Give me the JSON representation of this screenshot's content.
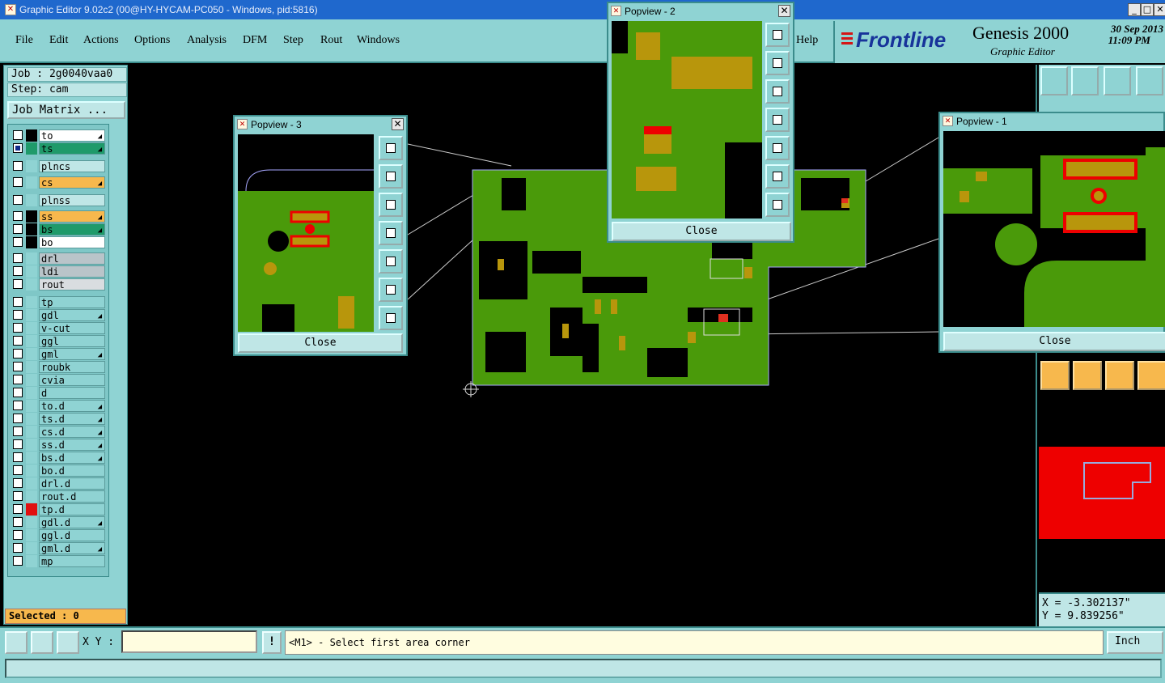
{
  "window": {
    "title": "Graphic Editor 9.02c2 (00@HY-HYCAM-PC050 - Windows, pid:5816)"
  },
  "menu": [
    {
      "label": "File"
    },
    {
      "label": "Edit"
    },
    {
      "label": "Actions"
    },
    {
      "label": "Options"
    },
    {
      "label": "Analysis"
    },
    {
      "label": "DFM"
    },
    {
      "label": "Step"
    },
    {
      "label": "Rout"
    },
    {
      "label": "Windows"
    },
    {
      "label": "Help"
    }
  ],
  "brand": {
    "logo": "Frontline",
    "product": "Genesis 2000",
    "subtitle": "Graphic Editor",
    "date": "30 Sep 2013",
    "time": "11:09 PM"
  },
  "job": {
    "job": "Job : 2g0040vaa0",
    "step": "Step: cam",
    "matrix_button": "Job Matrix ..."
  },
  "layers": [
    {
      "name": "to",
      "color": "#ffffff",
      "checked": false,
      "arrow": true,
      "swatch": "#000"
    },
    {
      "name": "ts",
      "color": "#1f9a6a",
      "checked": true,
      "arrow": true,
      "swatch": "#1f9a6a"
    },
    {
      "name": "plncs",
      "color": "#bfe6e6",
      "checked": false,
      "arrow": false,
      "swatch": ""
    },
    {
      "name": "cs",
      "color": "#f7b84d",
      "checked": false,
      "arrow": true,
      "swatch": ""
    },
    {
      "name": "plnss",
      "color": "#bfe6e6",
      "checked": false,
      "arrow": false,
      "swatch": ""
    },
    {
      "name": "ss",
      "color": "#f7b84d",
      "checked": false,
      "arrow": true,
      "swatch": "#000"
    },
    {
      "name": "bs",
      "color": "#1f9a6a",
      "checked": false,
      "arrow": true,
      "swatch": "#000"
    },
    {
      "name": "bo",
      "color": "#ffffff",
      "checked": false,
      "arrow": false,
      "swatch": "#000"
    },
    {
      "name": "drl",
      "color": "#b9c4c9",
      "checked": false,
      "arrow": false,
      "swatch": ""
    },
    {
      "name": "ldi",
      "color": "#b9c4c9",
      "checked": false,
      "arrow": false,
      "swatch": ""
    },
    {
      "name": "rout",
      "color": "#d9dde0",
      "checked": false,
      "arrow": false,
      "swatch": ""
    },
    {
      "name": "tp",
      "color": "#8fd3d3",
      "checked": false,
      "arrow": false,
      "swatch": ""
    },
    {
      "name": "gdl",
      "color": "#8fd3d3",
      "checked": false,
      "arrow": true,
      "swatch": ""
    },
    {
      "name": "v-cut",
      "color": "#8fd3d3",
      "checked": false,
      "arrow": false,
      "swatch": ""
    },
    {
      "name": "ggl",
      "color": "#8fd3d3",
      "checked": false,
      "arrow": false,
      "swatch": ""
    },
    {
      "name": "gml",
      "color": "#8fd3d3",
      "checked": false,
      "arrow": true,
      "swatch": ""
    },
    {
      "name": "roubk",
      "color": "#8fd3d3",
      "checked": false,
      "arrow": false,
      "swatch": ""
    },
    {
      "name": "cvia",
      "color": "#8fd3d3",
      "checked": false,
      "arrow": false,
      "swatch": ""
    },
    {
      "name": "d",
      "color": "#8fd3d3",
      "checked": false,
      "arrow": false,
      "swatch": ""
    },
    {
      "name": "to.d",
      "color": "#8fd3d3",
      "checked": false,
      "arrow": true,
      "swatch": ""
    },
    {
      "name": "ts.d",
      "color": "#8fd3d3",
      "checked": false,
      "arrow": true,
      "swatch": ""
    },
    {
      "name": "cs.d",
      "color": "#8fd3d3",
      "checked": false,
      "arrow": true,
      "swatch": ""
    },
    {
      "name": "ss.d",
      "color": "#8fd3d3",
      "checked": false,
      "arrow": true,
      "swatch": ""
    },
    {
      "name": "bs.d",
      "color": "#8fd3d3",
      "checked": false,
      "arrow": true,
      "swatch": ""
    },
    {
      "name": "bo.d",
      "color": "#8fd3d3",
      "checked": false,
      "arrow": false,
      "swatch": ""
    },
    {
      "name": "drl.d",
      "color": "#8fd3d3",
      "checked": false,
      "arrow": false,
      "swatch": ""
    },
    {
      "name": "rout.d",
      "color": "#8fd3d3",
      "checked": false,
      "arrow": false,
      "swatch": ""
    },
    {
      "name": "tp.d",
      "color": "#8fd3d3",
      "checked": false,
      "arrow": false,
      "swatch": "#e01010"
    },
    {
      "name": "gdl.d",
      "color": "#8fd3d3",
      "checked": false,
      "arrow": true,
      "swatch": ""
    },
    {
      "name": "ggl.d",
      "color": "#8fd3d3",
      "checked": false,
      "arrow": false,
      "swatch": ""
    },
    {
      "name": "gml.d",
      "color": "#8fd3d3",
      "checked": false,
      "arrow": true,
      "swatch": ""
    },
    {
      "name": "mp",
      "color": "#8fd3d3",
      "checked": false,
      "arrow": false,
      "swatch": ""
    }
  ],
  "selected": "Selected : 0",
  "popviews": [
    {
      "title": "Popview - 3",
      "close": "Close"
    },
    {
      "title": "Popview - 2",
      "close": "Close"
    },
    {
      "title": "Popview - 1",
      "close": "Close"
    }
  ],
  "coords": {
    "x": "X = -3.302137\"",
    "y": "Y = 9.839256\""
  },
  "command": {
    "xy_label": "X Y :",
    "xy_value": "",
    "prompt": "<M1> - Select first area corner",
    "units": "Inch"
  },
  "colors": {
    "board": "#4a9a0a",
    "pad": "#b8960c",
    "panel": "#8fd3d3",
    "highlight": "#f7b84d",
    "minimap": "#ee0000"
  }
}
